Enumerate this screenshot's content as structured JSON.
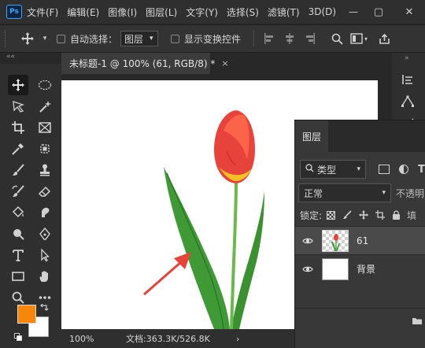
{
  "app": {
    "logo_text": "Ps"
  },
  "menu": {
    "items": [
      "文件(F)",
      "编辑(E)",
      "图像(I)",
      "图层(L)",
      "文字(Y)",
      "选择(S)",
      "滤镜(T)",
      "3D(D)"
    ]
  },
  "window_controls": {
    "minimize": "—",
    "maximize": "▢",
    "close": "✕"
  },
  "options": {
    "auto_select_label": "自动选择：",
    "auto_select_value": "图层",
    "show_transform_label": "显示变换控件",
    "collapse_glyph": "««"
  },
  "document": {
    "tab_title": "未标题-1 @ 100% (61, RGB/8) *",
    "tab_close": "×",
    "zoom": "100%",
    "doc_info": "文档:363.3K/526.8K",
    "status_arrow": "›"
  },
  "colors": {
    "foreground": "#f7860a",
    "background": "#ffffff",
    "accent_red": "#e8433b"
  },
  "tools": [
    "move-tool",
    "marquee-tool",
    "lasso-tool",
    "quick-select-tool",
    "crop-tool",
    "frame-tool",
    "eyedropper-tool",
    "patch-tool",
    "brush-tool",
    "stamp-tool",
    "history-brush-tool",
    "eraser-tool",
    "paint-bucket-tool",
    "smudge-tool",
    "dodge-tool",
    "pen-tool",
    "type-tool",
    "path-select-tool",
    "rectangle-tool",
    "hand-tool",
    "zoom-tool",
    "more-tools"
  ],
  "right_strip": {
    "icons": [
      "history-icon",
      "paths-icon",
      "adjust-icon"
    ]
  },
  "layers": {
    "tab_label": "图层",
    "filter_label": "类型",
    "blend_mode": "正常",
    "opacity_label": "不透明",
    "lock_label": "锁定:",
    "fill_label": "填",
    "items": [
      {
        "name": "61",
        "selected": true
      },
      {
        "name": "背景",
        "selected": false
      }
    ]
  }
}
